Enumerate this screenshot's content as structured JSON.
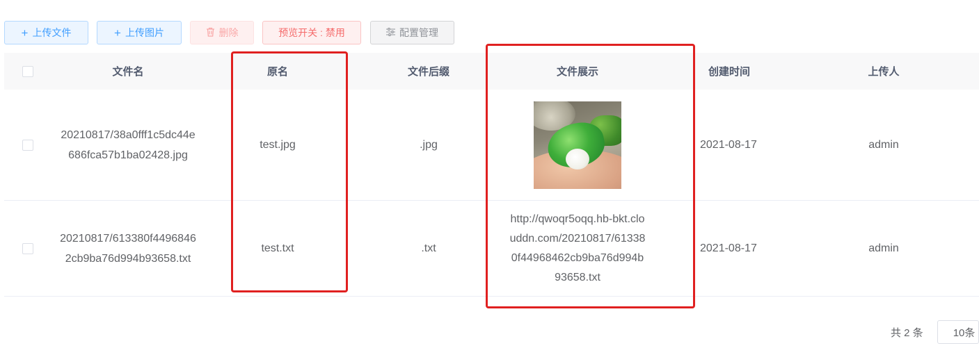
{
  "toolbar": {
    "upload_file_label": "上传文件",
    "upload_image_label": "上传图片",
    "delete_label": "删除",
    "preview_toggle_label": "预览开关 : 禁用",
    "config_manage_label": "配置管理"
  },
  "table": {
    "headers": {
      "file_name": "文件名",
      "original_name": "原名",
      "file_suffix": "文件后缀",
      "file_display": "文件展示",
      "create_time": "创建时间",
      "uploader": "上传人"
    },
    "rows": [
      {
        "file_name": "20210817/38a0fff1c5dc44e686fca57b1ba02428.jpg",
        "original_name": "test.jpg",
        "file_suffix": ".jpg",
        "file_display": "",
        "create_time": "2021-08-17",
        "uploader": "admin"
      },
      {
        "file_name": "20210817/613380f44968462cb9ba76d994b93658.txt",
        "original_name": "test.txt",
        "file_suffix": ".txt",
        "file_display": "http://qwoqr5oqq.hb-bkt.clouddn.com/20210817/613380f44968462cb9ba76d994b93658.txt",
        "create_time": "2021-08-17",
        "uploader": "admin"
      }
    ]
  },
  "pagination": {
    "total_text": "共 2 条",
    "page_size_text": "10条"
  },
  "colors": {
    "primary": "#409eff",
    "danger": "#f56c6c",
    "highlight": "#e02020"
  }
}
